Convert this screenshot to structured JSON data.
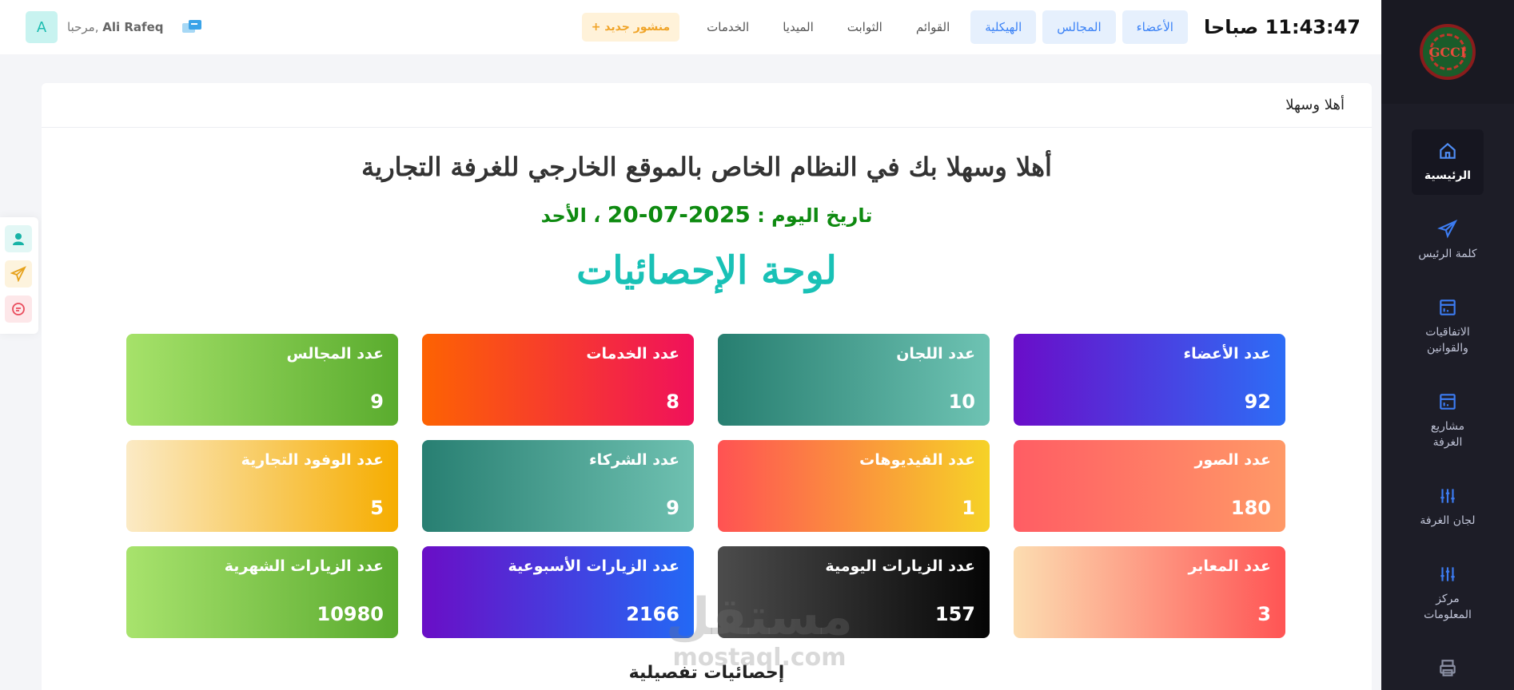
{
  "header": {
    "clock": "11:43:47 صباحا",
    "nav": [
      {
        "label": "الأعضاء",
        "style": "blue"
      },
      {
        "label": "المجالس",
        "style": "blue"
      },
      {
        "label": "الهيكلية",
        "style": "blue"
      },
      {
        "label": "القوائم",
        "style": "plain"
      },
      {
        "label": "الثوابت",
        "style": "plain"
      },
      {
        "label": "الميديا",
        "style": "plain"
      },
      {
        "label": "الخدمات",
        "style": "plain"
      }
    ],
    "new_post": "منشور جديد +",
    "greeting_prefix": "مرحبا,",
    "user_name": "Ali Rafeq",
    "avatar_letter": "A"
  },
  "sidebar": {
    "logo_text": "GCCI",
    "items": [
      {
        "label": "الرئيسية",
        "icon": "home-icon",
        "active": true
      },
      {
        "label": "كلمة الرئيس",
        "icon": "send-icon",
        "active": false
      },
      {
        "label": "الاتفاقيات والقوانين",
        "icon": "document-icon",
        "active": false
      },
      {
        "label": "مشاريع الغرفة",
        "icon": "document-icon",
        "active": false
      },
      {
        "label": "لجان الغرفة",
        "icon": "sliders-icon",
        "active": false
      },
      {
        "label": "مركز المعلومات",
        "icon": "sliders-icon",
        "active": false
      },
      {
        "label": "-",
        "icon": "printer-icon",
        "active": false
      }
    ]
  },
  "main": {
    "card_title": "أهلا وسهلا",
    "welcome": "أهلا وسهلا بك في النظام الخاص بالموقع الخارجي للغرفة التجارية",
    "date_label": "تاريخ اليوم :",
    "date_value": "2025-07-20",
    "date_day": "، الأحد",
    "stats_title": "لوحة الإحصائيات",
    "stats": [
      {
        "label": "عدد الأعضاء",
        "value": "92",
        "gradient": "g-blue-purple"
      },
      {
        "label": "عدد اللجان",
        "value": "10",
        "gradient": "g-teal"
      },
      {
        "label": "عدد الخدمات",
        "value": "8",
        "gradient": "g-orange-pink"
      },
      {
        "label": "عدد المجالس",
        "value": "9",
        "gradient": "g-green"
      },
      {
        "label": "عدد الصور",
        "value": "180",
        "gradient": "g-coral"
      },
      {
        "label": "عدد الفيديوهات",
        "value": "1",
        "gradient": "g-red-yellow"
      },
      {
        "label": "عدد الشركاء",
        "value": "9",
        "gradient": "g-teal2"
      },
      {
        "label": "عدد الوفود التجارية",
        "value": "5",
        "gradient": "g-yellow"
      },
      {
        "label": "عدد المعابر",
        "value": "3",
        "gradient": "g-peach"
      },
      {
        "label": "عدد الزيارات اليومية",
        "value": "157",
        "gradient": "g-black"
      },
      {
        "label": "عدد الزيارات الأسبوعية",
        "value": "2166",
        "gradient": "g-blue-purple2"
      },
      {
        "label": "عدد الزيارات الشهرية",
        "value": "10980",
        "gradient": "g-green2"
      }
    ],
    "detail_title": "إحصائيات تفصيلية"
  },
  "watermark": {
    "line1": "مستقل",
    "line2": "mostaql.com"
  },
  "colors": {
    "accent": "#19c1b6",
    "date": "#0e8a10",
    "sidebar_bg": "#1d1d27",
    "nav_blue": "#3b82f6"
  }
}
